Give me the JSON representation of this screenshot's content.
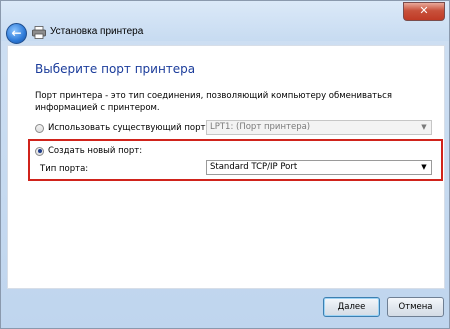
{
  "window": {
    "title": "Установка принтера",
    "close_glyph": "✕",
    "back_glyph": "←"
  },
  "page": {
    "heading": "Выберите порт принтера",
    "description": "Порт принтера - это тип соединения, позволяющий компьютеру обмениваться информацией с принтером."
  },
  "options": {
    "existing": {
      "label": "Использовать существующий порт:",
      "selected_value": "LPT1: (Порт принтера)",
      "checked": false
    },
    "new_port": {
      "label": "Создать новый порт:",
      "checked": true,
      "port_type_label": "Тип порта:",
      "port_type_value": "Standard TCP/IP Port"
    }
  },
  "buttons": {
    "next": "Далее",
    "cancel": "Отмена"
  },
  "colors": {
    "heading": "#1b3c9b",
    "highlight": "#d0231b",
    "close_button": "#c8513b"
  },
  "icons": {
    "back": "back-arrow-icon",
    "printer": "printer-icon",
    "close": "close-icon",
    "dropdown": "chevron-down-icon"
  }
}
